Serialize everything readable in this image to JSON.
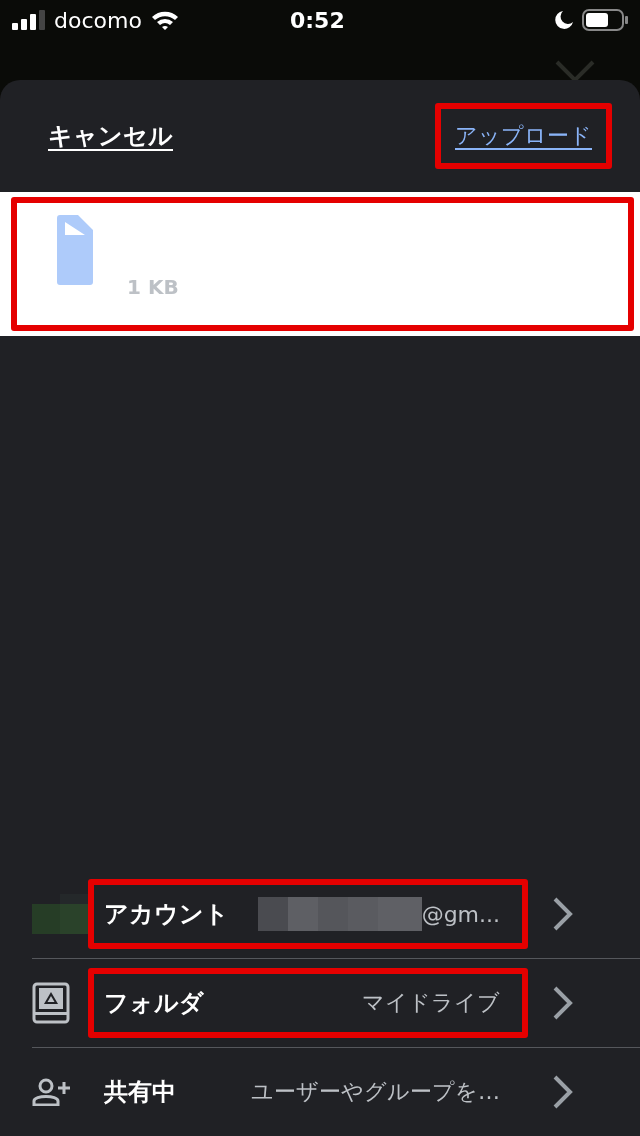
{
  "status_bar": {
    "carrier": "docomo",
    "time": "0:52"
  },
  "header": {
    "cancel": "キャンセル",
    "upload": {
      "label": "アップロード",
      "highlighted": true
    }
  },
  "file": {
    "size": "1 KB",
    "highlighted": true
  },
  "rows": [
    {
      "kind": "avatar",
      "label": "アカウント",
      "value": "@gm...",
      "redacted": true,
      "highlighted": true
    },
    {
      "kind": "folder",
      "label": "フォルダ",
      "value": "マイドライブ",
      "redacted": false,
      "highlighted": true
    },
    {
      "kind": "share",
      "label": "共有中",
      "value": "ユーザーやグループを…",
      "redacted": false,
      "highlighted": false
    }
  ]
}
